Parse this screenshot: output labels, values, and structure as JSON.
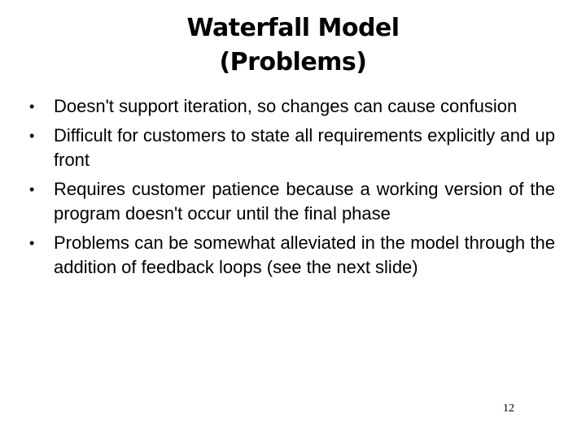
{
  "slide": {
    "title_lines": [
      "Waterfall Model",
      "(Problems)"
    ],
    "bullet_glyph": "•",
    "bullets": [
      "Doesn't support iteration, so changes can cause confusion",
      "Difficult for customers to state all requirements explicitly and up front",
      "Requires customer patience because a working version of the program doesn't occur until the final phase",
      "Problems can be somewhat alleviated in the model through the addition of feedback loops (see the next slide)"
    ],
    "page_number": "12"
  }
}
